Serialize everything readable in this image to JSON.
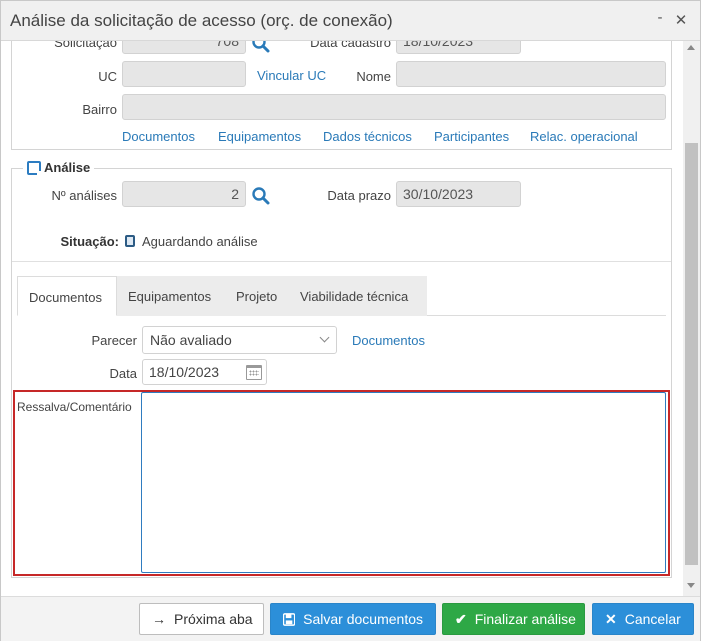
{
  "window": {
    "title": "Análise da solicitação de acesso (orç. de conexão)",
    "minimize_icon": "minimize-icon",
    "close_icon": "close-icon"
  },
  "request": {
    "solicitacao_label": "Solicitação",
    "solicitacao_value": "708",
    "data_cadastro_label": "Data cadastro",
    "data_cadastro_value": "18/10/2023",
    "uc_label": "UC",
    "uc_value": "",
    "vincular_uc_link": "Vincular UC",
    "nome_label": "Nome",
    "nome_value": "",
    "bairro_label": "Bairro",
    "bairro_value": ""
  },
  "links": {
    "documentos": "Documentos",
    "equipamentos": "Equipamentos",
    "dados_tecnicos": "Dados técnicos",
    "participantes": "Participantes",
    "relac_operacional": "Relac. operacional"
  },
  "analise": {
    "legend": "Análise",
    "n_analises_label": "Nº análises",
    "n_analises_value": "2",
    "data_prazo_label": "Data prazo",
    "data_prazo_value": "30/10/2023",
    "situacao_label": "Situação:",
    "situacao_value": "Aguardando análise"
  },
  "tabs": [
    {
      "label": "Documentos",
      "active": true
    },
    {
      "label": "Equipamentos",
      "active": false
    },
    {
      "label": "Projeto",
      "active": false
    },
    {
      "label": "Viabilidade técnica",
      "active": false
    }
  ],
  "documentos_tab": {
    "parecer_label": "Parecer",
    "parecer_value": "Não avaliado",
    "documentos_link": "Documentos",
    "data_label": "Data",
    "data_value": "18/10/2023",
    "ressalva_label": "Ressalva/Comentário",
    "ressalva_value": ""
  },
  "footer": {
    "proxima_aba": "Próxima aba",
    "salvar_documentos": "Salvar documentos",
    "finalizar_analise": "Finalizar análise",
    "cancelar": "Cancelar"
  },
  "colors": {
    "accent_blue": "#2c8fd9",
    "success_green": "#2ea846",
    "link_blue": "#2a7ab8",
    "highlight_red": "#c62828"
  }
}
